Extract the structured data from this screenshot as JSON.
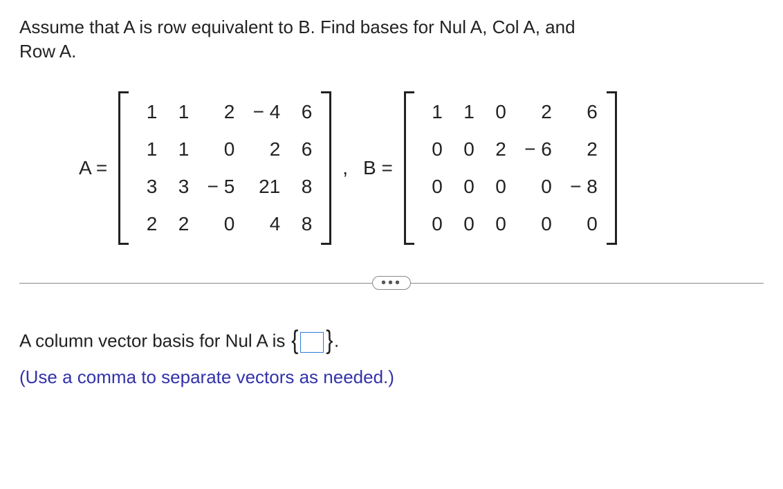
{
  "question": {
    "text_line1": "Assume that A is row equivalent to B. Find bases for Nul A, Col A, and",
    "text_line2": "Row A."
  },
  "matrices": {
    "A": {
      "label": "A =",
      "rows": [
        [
          "1",
          "1",
          "2",
          "− 4",
          "6"
        ],
        [
          "1",
          "1",
          "0",
          "2",
          "6"
        ],
        [
          "3",
          "3",
          "− 5",
          "21",
          "8"
        ],
        [
          "2",
          "2",
          "0",
          "4",
          "8"
        ]
      ]
    },
    "sep": ",",
    "B": {
      "label": "B =",
      "rows": [
        [
          "1",
          "1",
          "0",
          "2",
          "6"
        ],
        [
          "0",
          "0",
          "2",
          "− 6",
          "2"
        ],
        [
          "0",
          "0",
          "0",
          "0",
          "− 8"
        ],
        [
          "0",
          "0",
          "0",
          "0",
          "0"
        ]
      ]
    }
  },
  "divider": {
    "ellipsis": "•••"
  },
  "answer": {
    "prompt_prefix": "A column vector basis for Nul A is ",
    "brace_left": "{",
    "brace_right": "}",
    "period": ".",
    "hint": "(Use a comma to separate vectors as needed.)"
  }
}
